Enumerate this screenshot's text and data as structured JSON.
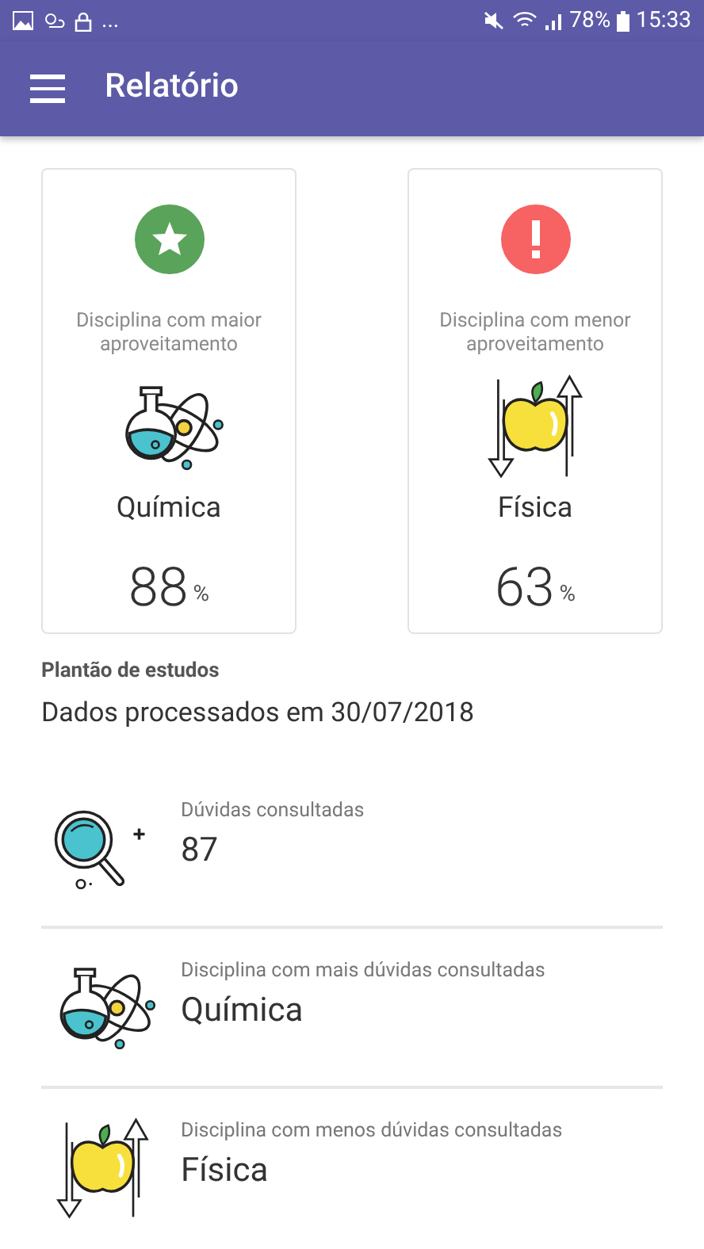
{
  "status_bar": {
    "overflow": "...",
    "battery": "78%",
    "time": "15:33"
  },
  "app_bar": {
    "title": "Relatório"
  },
  "cards": [
    {
      "kind": "best",
      "caption": "Disciplina com maior aproveitamento",
      "illustration": {
        "kind": "flask"
      },
      "subject": "Química",
      "value": "88",
      "unit": "%"
    },
    {
      "kind": "worst",
      "caption": "Disciplina com menor aproveitamento",
      "illustration": {
        "kind": "apple"
      },
      "subject": "Física",
      "value": "63",
      "unit": "%"
    }
  ],
  "section": {
    "title": "Plantão de estudos",
    "subtitle": "Dados processados em 30/07/2018"
  },
  "stats": [
    {
      "illustration": {
        "kind": "magnifier"
      },
      "label": "Dúvidas consultadas",
      "value": "87"
    },
    {
      "illustration": {
        "kind": "flask"
      },
      "label": "Disciplina com mais dúvidas consultadas",
      "value": "Química"
    },
    {
      "illustration": {
        "kind": "apple"
      },
      "label": "Disciplina com menos dúvidas consultadas",
      "value": "Física"
    }
  ]
}
